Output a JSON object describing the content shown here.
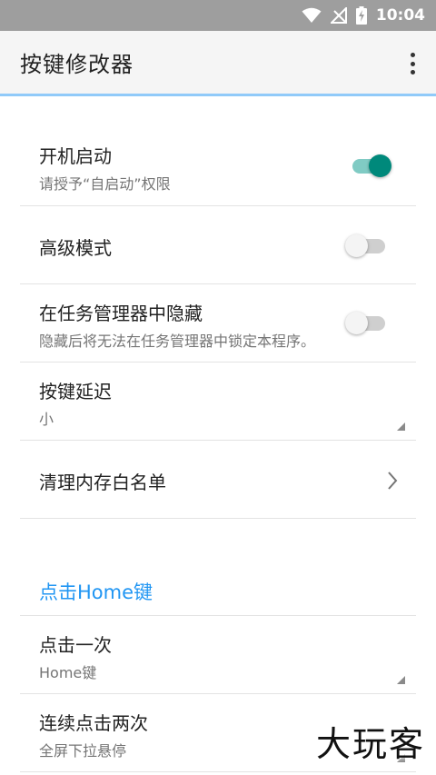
{
  "status_bar": {
    "time": "10:04",
    "icons": [
      "wifi-icon",
      "no-signal-icon",
      "battery-charging-icon"
    ],
    "background": "#9e9e9e"
  },
  "app_bar": {
    "title": "按键修改器",
    "overflow_icon": "more-vert-icon"
  },
  "settings": {
    "boot_start": {
      "title": "开机启动",
      "summary": "请授予“自启动”权限",
      "enabled": true
    },
    "advanced_mode": {
      "title": "高级模式",
      "enabled": false
    },
    "hide_in_task_manager": {
      "title": "在任务管理器中隐藏",
      "summary": "隐藏后将无法在任务管理器中锁定本程序。",
      "enabled": false
    },
    "key_delay": {
      "title": "按键延迟",
      "value": "小"
    },
    "memory_whitelist": {
      "title": "清理内存白名单",
      "icon": "chevron-right-icon"
    }
  },
  "home_section": {
    "header": "点击Home键",
    "single_click": {
      "title": "点击一次",
      "value": "Home键"
    },
    "double_click": {
      "title": "连续点击两次",
      "value": "全屏下拉悬停"
    }
  },
  "watermark": "大玩客",
  "colors": {
    "accent": "#00897b",
    "accent_light": "#80cbc4",
    "section_header": "#2196f3",
    "app_bar_border": "#90caf9"
  }
}
